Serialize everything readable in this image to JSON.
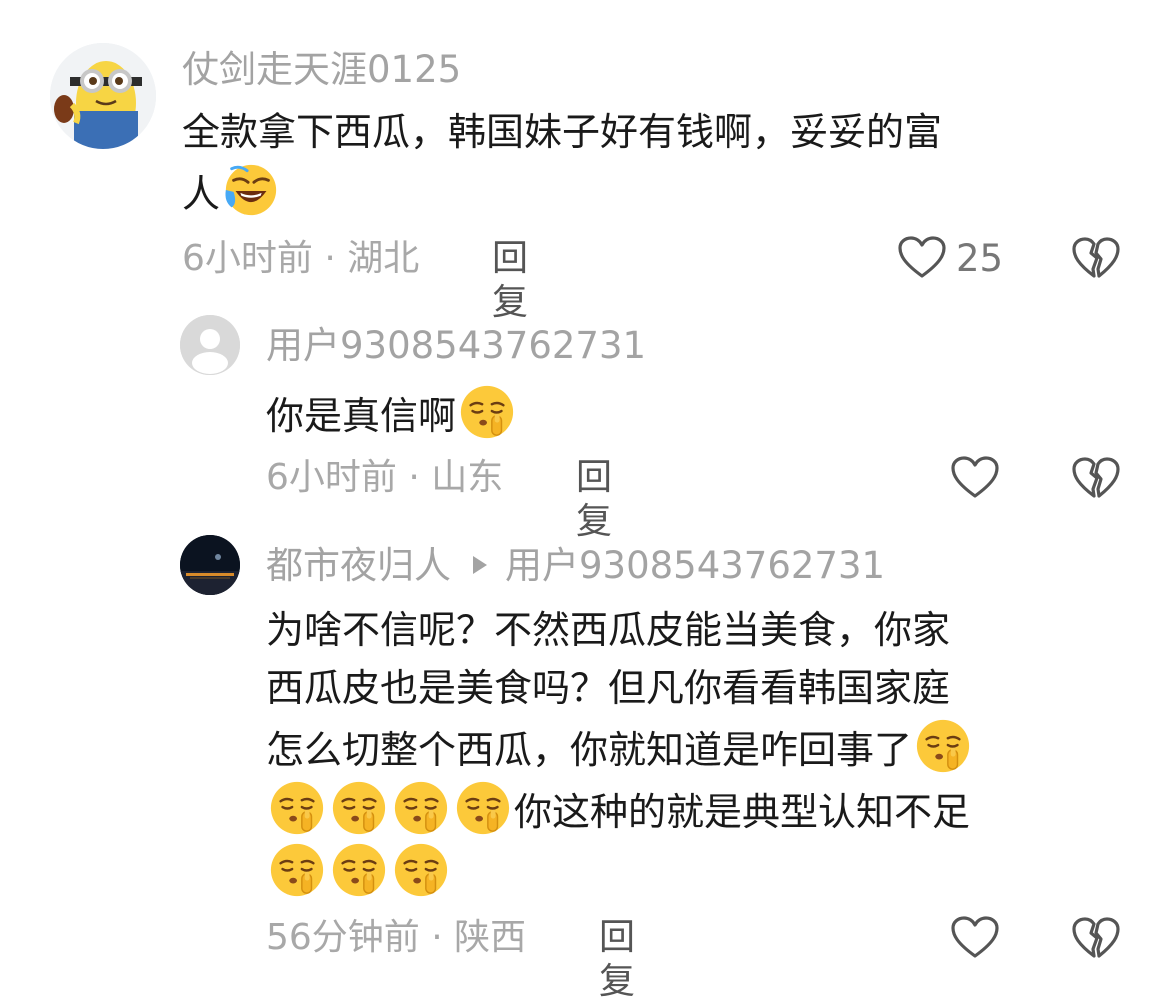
{
  "comments": [
    {
      "username": "仗剑走天涯0125",
      "text_line1": "全款拿下西瓜，韩国妹子好有钱啊，妥妥的富",
      "text_line2": "人",
      "emoji": "laughing-crying",
      "time_location": "6小时前 · 湖北",
      "reply_label": "回复",
      "likes": "25"
    },
    {
      "username": "用户9308543762731",
      "text": "你是真信啊",
      "emoji": "shush-face",
      "time_location": "6小时前 · 山东",
      "reply_label": "回复"
    },
    {
      "username": "都市夜归人",
      "reply_to": "用户9308543762731",
      "lines": [
        "为啥不信呢？不然西瓜皮能当美食，你家",
        "西瓜皮也是美食吗？但凡你看看韩国家庭",
        "怎么切整个西瓜，你就知道是咋回事了",
        "你这种的就是典型认知不足"
      ],
      "time_location": "56分钟前 · 陕西",
      "reply_label": "回复"
    }
  ]
}
